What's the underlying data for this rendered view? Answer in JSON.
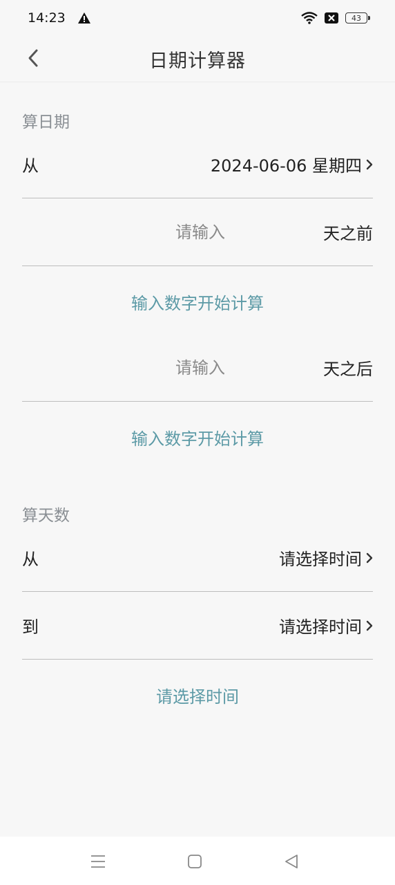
{
  "status_bar": {
    "time": "14:23",
    "battery_level": "43",
    "icons": [
      "warning-icon",
      "wifi-icon",
      "sim-off-icon",
      "battery-icon"
    ]
  },
  "header": {
    "title": "日期计算器",
    "back_icon": "chevron-left-icon"
  },
  "calc_date": {
    "section_title": "算日期",
    "from_label": "从",
    "from_value": "2024-06-06 星期四",
    "before": {
      "placeholder": "请输入",
      "unit": "天之前",
      "result": "输入数字开始计算"
    },
    "after": {
      "placeholder": "请输入",
      "unit": "天之后",
      "result": "输入数字开始计算"
    }
  },
  "calc_days": {
    "section_title": "算天数",
    "from_label": "从",
    "from_value": "请选择时间",
    "to_label": "到",
    "to_value": "请选择时间",
    "result": "请选择时间"
  },
  "colors": {
    "accent": "#5c9aa6",
    "background": "#f7f7f7",
    "muted": "#8a8f94"
  },
  "system_nav": {
    "icons": [
      "menu-icon",
      "home-icon",
      "back-triangle-icon"
    ]
  }
}
